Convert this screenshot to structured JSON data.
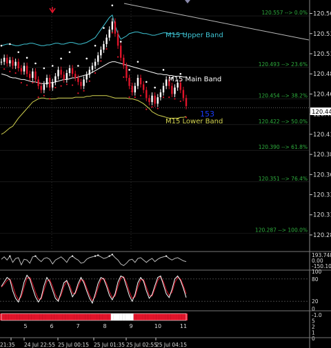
{
  "chart_data": {
    "type": "line",
    "symbol_hint": "USDJPY M5",
    "price_axis": {
      "ylim": [
        120.267,
        120.575
      ],
      "ticks": [
        "120.560",
        "120.535",
        "120.510",
        "120.485",
        "120.460",
        "120.435",
        "120.410",
        "120.385",
        "120.360",
        "120.335",
        "120.310",
        "120.285"
      ],
      "current_price": "120.443"
    },
    "fib_levels": [
      {
        "label": "120.557 --> 0.0%",
        "value": 120.557
      },
      {
        "label": "120.493 --> 23.6%",
        "value": 120.493
      },
      {
        "label": "120.454 --> 38.2%",
        "value": 120.454
      },
      {
        "label": "120.422 --> 50.0%",
        "value": 120.422
      },
      {
        "label": "120.390 --> 61.8%",
        "value": 120.39
      },
      {
        "label": "120.351 --> 76.4%",
        "value": 120.351
      },
      {
        "label": "120.287 --> 100.0%",
        "value": 120.287
      }
    ],
    "bands": [
      {
        "name": "M15 Upper Band",
        "color": "#3fc6d6"
      },
      {
        "name": "M15 Main Band",
        "color": "#ffffff"
      },
      {
        "name": "M15 Lower Band",
        "color": "#d4d450"
      }
    ],
    "marker_text": "153",
    "x_index": [
      0,
      1,
      2,
      3,
      4,
      5,
      6,
      7,
      8,
      9,
      10,
      11,
      12,
      13,
      14,
      15,
      16,
      17,
      18,
      19,
      20,
      21,
      22,
      23,
      24,
      25,
      26,
      27,
      28,
      29,
      30,
      31,
      32,
      33,
      34,
      35,
      36,
      37,
      38,
      39,
      40,
      41,
      42,
      43,
      44,
      45,
      46,
      47,
      48,
      49,
      50,
      51,
      52,
      53,
      54,
      55,
      56,
      57,
      58,
      59,
      60,
      61,
      62,
      63,
      64,
      65
    ],
    "series": [
      {
        "values": [
          120.5,
          120.505,
          120.498,
          120.502,
          120.495,
          120.5,
          120.492,
          120.488,
          120.495,
          120.485,
          120.48,
          120.488,
          120.478,
          120.47,
          120.465,
          120.472,
          120.48,
          120.468,
          120.475,
          120.482,
          120.49,
          120.484,
          120.478,
          120.486,
          120.492,
          120.485,
          120.48,
          120.475,
          120.47,
          120.478,
          120.484,
          120.49,
          120.495,
          120.5,
          120.508,
          120.515,
          120.522,
          120.53,
          120.54,
          120.55,
          120.535,
          120.52,
          120.505,
          120.495,
          120.48,
          120.47,
          120.462,
          120.47,
          120.48,
          120.472,
          120.465,
          120.455,
          120.45,
          120.458,
          120.448,
          120.456,
          120.462,
          120.47,
          120.478,
          120.47,
          120.46,
          120.468,
          120.474,
          120.465,
          120.455,
          120.445
        ]
      },
      {
        "name": "M15 Upper Band",
        "values": [
          120.52,
          120.521,
          120.522,
          120.522,
          120.521,
          120.52,
          120.52,
          120.521,
          120.522,
          120.522,
          120.523,
          120.523,
          120.522,
          120.521,
          120.52,
          120.52,
          120.521,
          120.521,
          120.522,
          120.523,
          120.523,
          120.522,
          120.522,
          120.523,
          120.524,
          120.524,
          120.523,
          120.522,
          120.522,
          120.523,
          120.524,
          120.526,
          120.528,
          120.53,
          120.535,
          120.54,
          120.545,
          120.55,
          120.555,
          120.558,
          120.545,
          120.535,
          120.528,
          120.53,
          120.532,
          120.535,
          120.536,
          120.537,
          120.537,
          120.536,
          120.535,
          120.535,
          120.534,
          120.533,
          120.533,
          120.534,
          120.535,
          120.536,
          120.536,
          120.535,
          120.535,
          120.534,
          120.534,
          120.535,
          120.535,
          120.534
        ]
      },
      {
        "name": "M15 Main Band",
        "values": [
          120.485,
          120.484,
          120.483,
          120.481,
          120.48,
          120.48,
          120.479,
          120.478,
          120.478,
          120.477,
          120.476,
          120.475,
          120.475,
          120.474,
          120.473,
          120.473,
          120.473,
          120.474,
          120.474,
          120.475,
          120.476,
          120.477,
          120.478,
          120.478,
          120.479,
          120.48,
          120.48,
          120.481,
          120.482,
          120.483,
          120.484,
          120.485,
          120.487,
          120.489,
          120.491,
          120.493,
          120.495,
          120.497,
          120.499,
          120.5,
          120.5,
          120.499,
          120.498,
          120.497,
          120.496,
          120.495,
          120.494,
          120.493,
          120.492,
          120.491,
          120.49,
          120.489,
          120.488,
          120.487,
          120.486,
          120.485,
          120.485,
          120.484,
          120.484,
          120.483,
          120.483,
          120.482,
          120.482,
          120.482,
          120.481,
          120.481
        ]
      },
      {
        "name": "M15 Lower Band",
        "values": [
          120.41,
          120.412,
          120.415,
          120.418,
          120.42,
          120.425,
          120.43,
          120.434,
          120.438,
          120.442,
          120.446,
          120.45,
          120.452,
          120.454,
          120.455,
          120.455,
          120.454,
          120.454,
          120.454,
          120.454,
          120.455,
          120.455,
          120.455,
          120.455,
          120.455,
          120.455,
          120.456,
          120.456,
          120.456,
          120.456,
          120.457,
          120.457,
          120.458,
          120.458,
          120.458,
          120.458,
          120.458,
          120.458,
          120.457,
          120.456,
          120.455,
          120.455,
          120.455,
          120.455,
          120.455,
          120.454,
          120.454,
          120.453,
          120.452,
          120.45,
          120.448,
          120.445,
          120.442,
          120.438,
          120.436,
          120.434,
          120.433,
          120.432,
          120.431,
          120.43,
          120.43,
          120.43,
          120.43,
          120.431,
          120.431,
          120.432
        ]
      }
    ],
    "oscillator_1": {
      "labels": [
        "193.7487",
        "0.00",
        "-150.107"
      ],
      "values": [
        0.2,
        0.5,
        0.1,
        0.6,
        -0.2,
        0.3,
        0.4,
        -0.5,
        0.2,
        0.1,
        -0.3,
        0.5,
        0.6,
        0.2,
        -0.1,
        0.3,
        0.4,
        0.2,
        -0.4,
        0.1,
        0.3,
        0.5,
        0.2,
        -0.2,
        0.4,
        0.6,
        0.3,
        0.1,
        -0.3,
        -0.2,
        0.2,
        0.4,
        0.5,
        0.6,
        0.7,
        0.5,
        0.3,
        0.4,
        0.6,
        0.8,
        0.4,
        0.1,
        -0.4,
        -0.6,
        -0.3,
        0.1,
        0.2,
        -0.2,
        0.3,
        0.4,
        0.1,
        -0.2,
        0.1,
        0.3,
        -0.1,
        0.2,
        0.4,
        0.5,
        0.6,
        0.3,
        0.1,
        0.3,
        0.4,
        0.2,
        0.0,
        -0.1
      ],
      "ylim": [
        -1,
        1
      ]
    },
    "stochastic": {
      "labels": [
        "100",
        "80",
        "20",
        "0"
      ],
      "main": [
        60,
        72,
        84,
        78,
        48,
        28,
        18,
        40,
        72,
        90,
        80,
        55,
        32,
        18,
        30,
        62,
        84,
        72,
        50,
        28,
        20,
        44,
        70,
        76,
        55,
        32,
        44,
        68,
        84,
        70,
        48,
        28,
        15,
        40,
        68,
        84,
        80,
        60,
        36,
        24,
        40,
        72,
        88,
        84,
        60,
        35,
        20,
        38,
        70,
        84,
        74,
        48,
        28,
        38,
        62,
        84,
        88,
        64,
        40,
        30,
        52,
        80,
        88,
        76,
        55,
        30
      ],
      "signal": [
        58,
        66,
        76,
        80,
        62,
        38,
        24,
        32,
        58,
        82,
        84,
        66,
        44,
        26,
        26,
        50,
        74,
        78,
        60,
        38,
        24,
        36,
        60,
        74,
        64,
        42,
        40,
        60,
        78,
        76,
        56,
        36,
        22,
        32,
        56,
        78,
        82,
        68,
        46,
        30,
        34,
        60,
        82,
        86,
        70,
        46,
        28,
        32,
        58,
        78,
        78,
        58,
        36,
        34,
        54,
        76,
        86,
        72,
        50,
        36,
        44,
        70,
        84,
        80,
        62,
        40
      ],
      "ylim": [
        0,
        100
      ]
    },
    "signal_bar": {
      "labels": [
        "5",
        "6",
        "7",
        "8",
        "9",
        "10",
        "11"
      ],
      "states": [
        "R",
        "R",
        "R",
        "R",
        "R",
        "R",
        "R",
        "R",
        "R",
        "R",
        "R",
        "R",
        "R",
        "R",
        "R",
        "R",
        "R",
        "R",
        "R",
        "R",
        "R",
        "R",
        "R",
        "R",
        "R",
        "R",
        "R",
        "R",
        "R",
        "R",
        "R",
        "R",
        "R",
        "R",
        "R",
        "R",
        "R",
        "R",
        "R",
        "W",
        "W",
        "W",
        "W",
        "W",
        "W",
        "W",
        "W",
        "R",
        "R",
        "R",
        "R",
        "R",
        "R",
        "R",
        "R",
        "R",
        "R",
        "R",
        "R",
        "R",
        "R",
        "R",
        "R",
        "R",
        "R",
        "R"
      ],
      "colors": {
        "R": "#e0142a",
        "W": "#ffffff"
      }
    },
    "right_labels": [
      "-1.0",
      "5",
      "2",
      "1",
      "0"
    ],
    "time_labels": [
      "21:35",
      "24 Jul 22:55",
      "25 Jul 00:15",
      "25 Jul 01:35",
      "25 Jul 02:55",
      "25 Jul 04:15"
    ]
  }
}
